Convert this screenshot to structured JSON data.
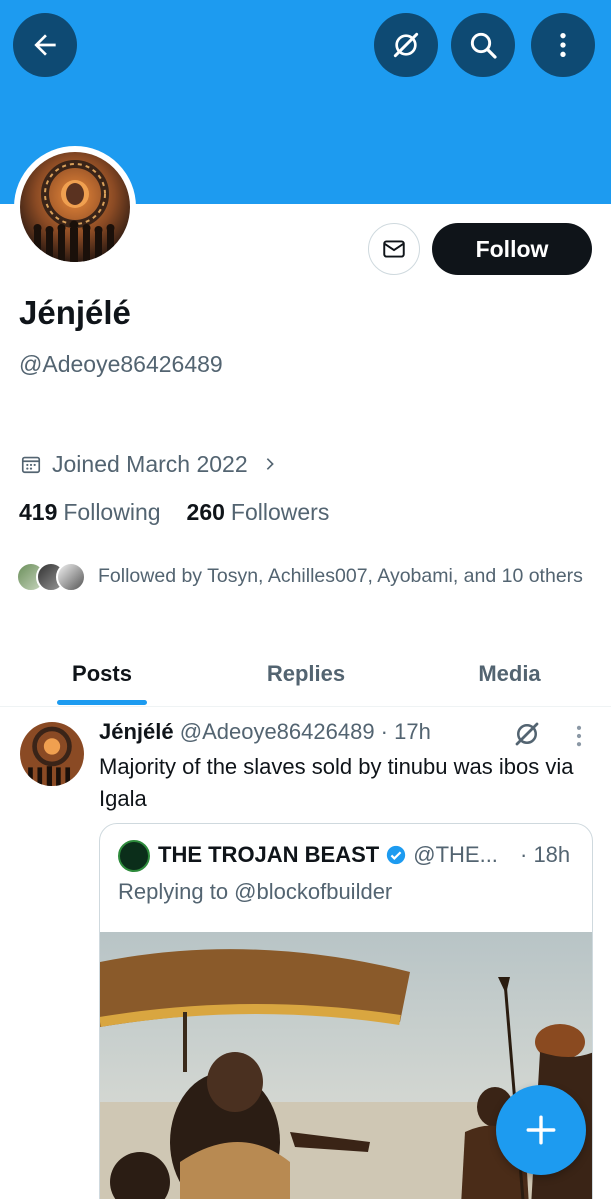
{
  "header": {
    "back_icon": "back-arrow-icon",
    "grok_icon": "grok-icon",
    "search_icon": "search-icon",
    "more_icon": "more-vertical-icon"
  },
  "profile": {
    "name": "Jénjélé",
    "handle": "@Adeoye86426489",
    "joined": "Joined March 2022",
    "following_count": "419",
    "following_label": "Following",
    "followers_count": "260",
    "followers_label": "Followers",
    "followed_by": "Followed by Tosyn, Achilles007, Ayobami, and 10 others",
    "follow_label": "Follow"
  },
  "tabs": [
    {
      "label": "Posts",
      "active": true
    },
    {
      "label": "Replies",
      "active": false
    },
    {
      "label": "Media",
      "active": false
    }
  ],
  "post": {
    "author_name": "Jénjélé",
    "author_handle_time": "@Adeoye86426489 · 17h",
    "text": "Majority of the slaves sold by tinubu was ibos via Igala",
    "quote": {
      "name": "THE TROJAN BEAST",
      "handle": "@THE...",
      "time": "· 18h",
      "replying_to": "Replying to @blockofbuilder"
    }
  },
  "colors": {
    "accent": "#1d9bf0",
    "banner": "#1d9bf0",
    "dark_button": "#0f1419",
    "secondary_text": "#536471"
  }
}
